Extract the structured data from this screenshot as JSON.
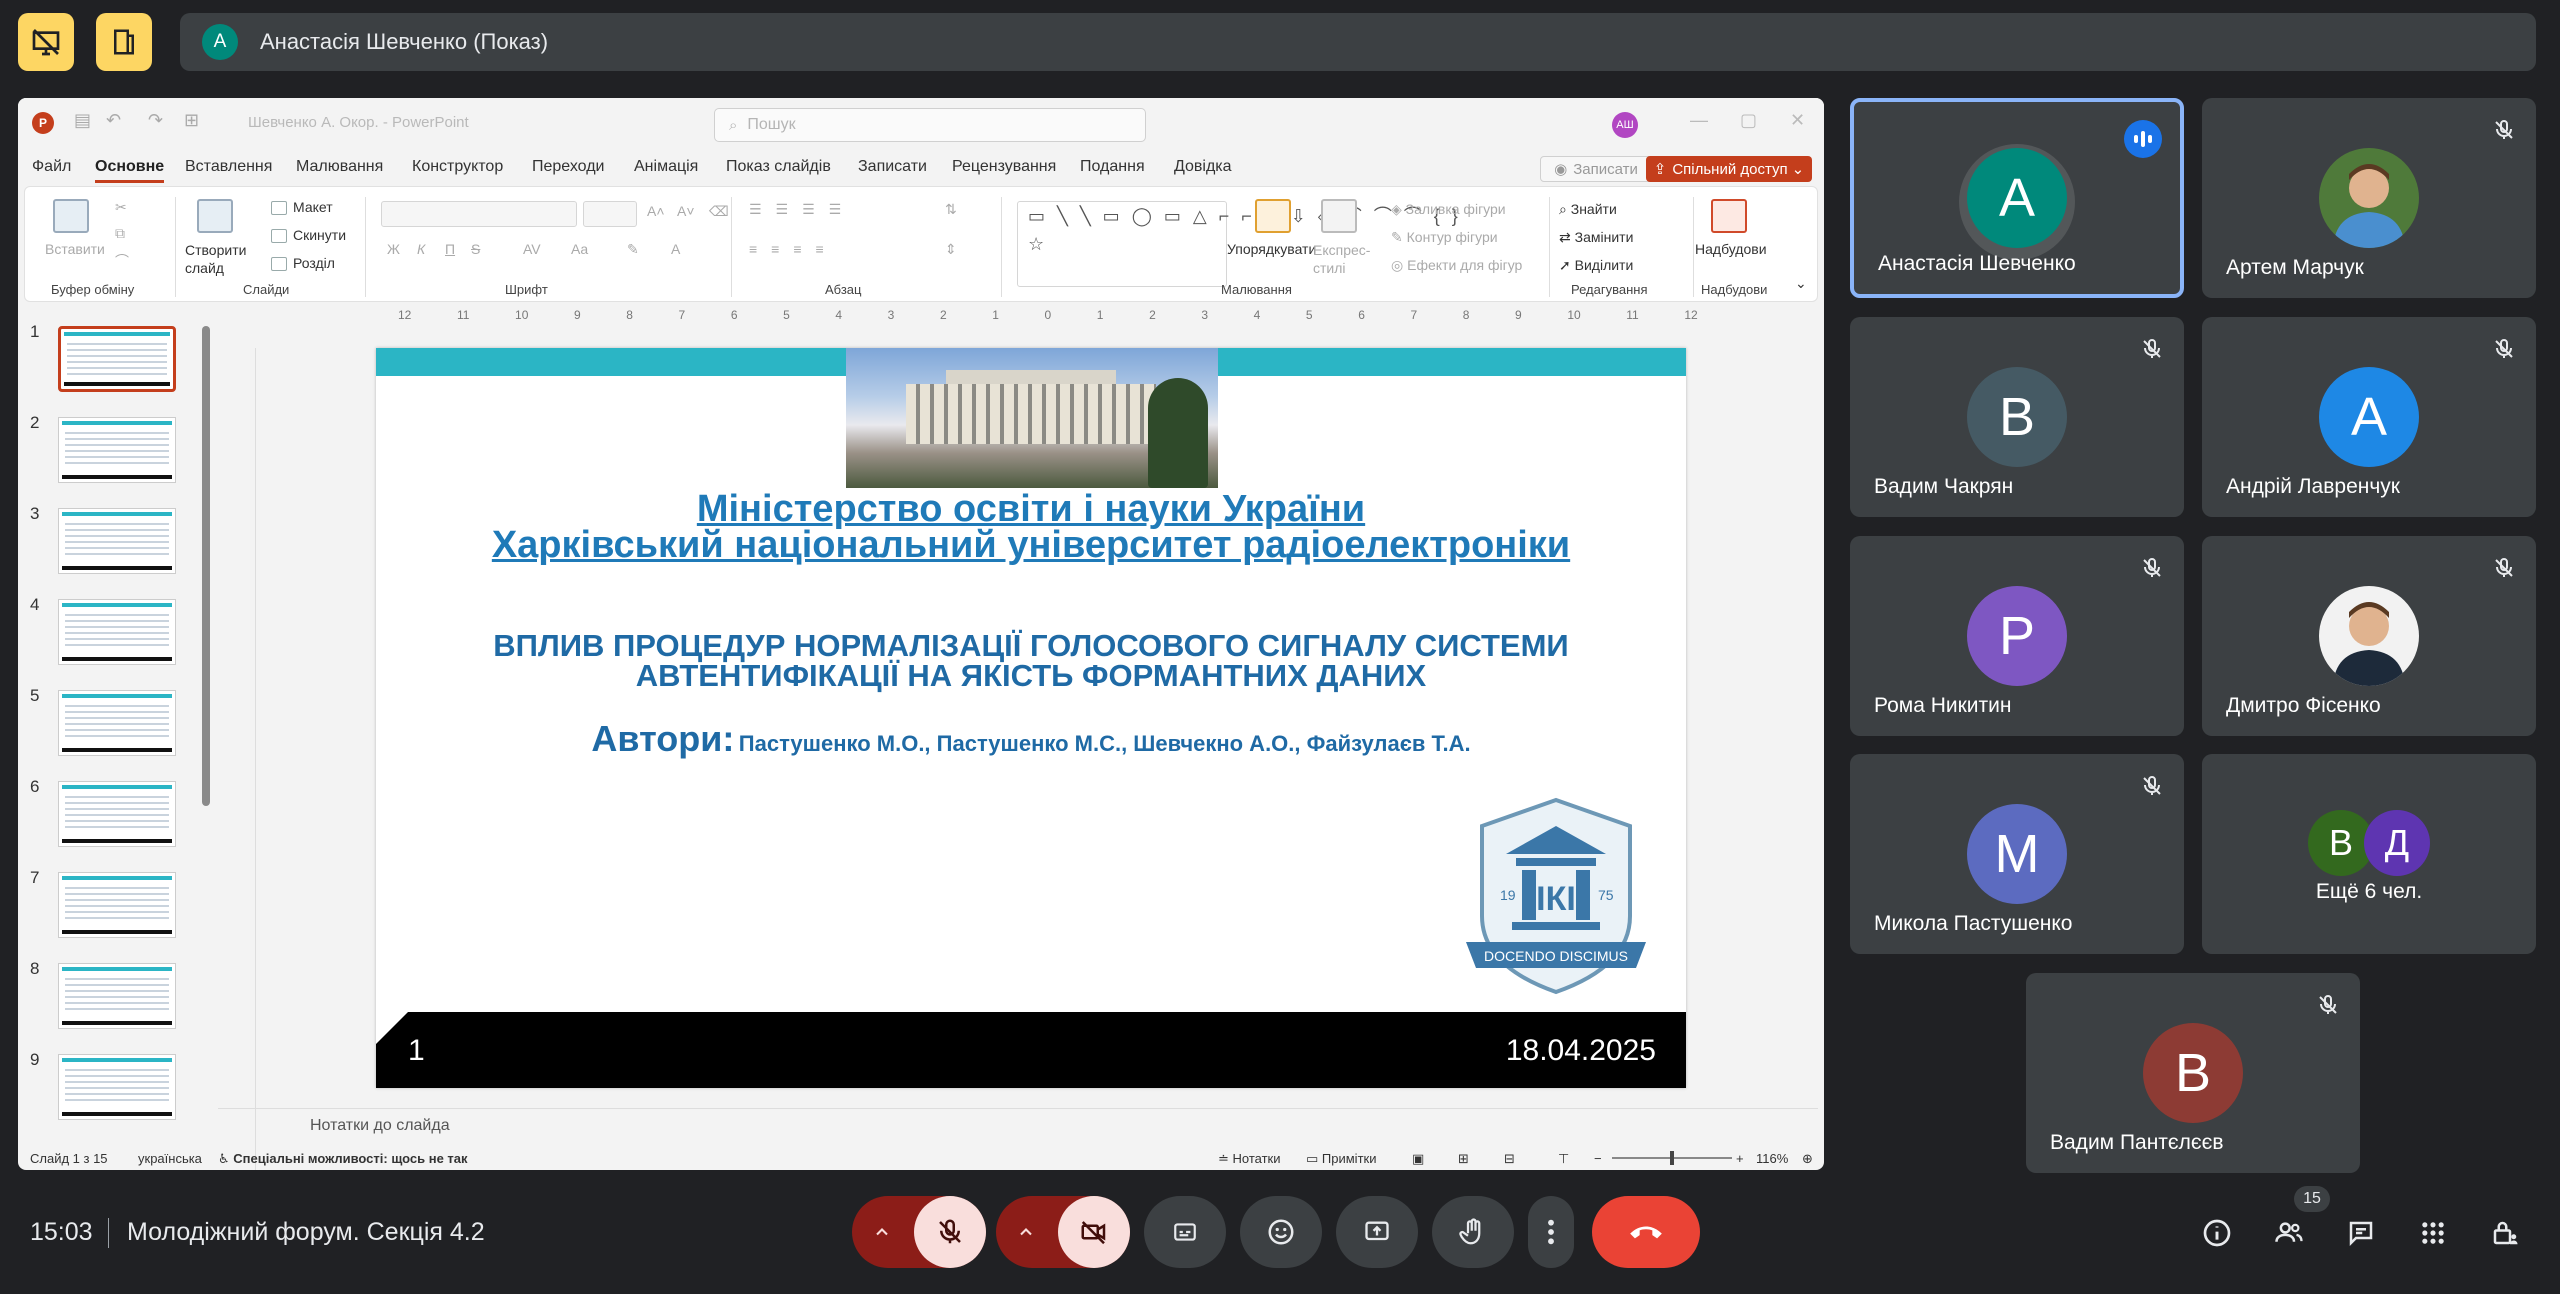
{
  "presenter": {
    "initial": "А",
    "label": "Анастасія Шевченко (Показ)"
  },
  "ppt": {
    "doc_title": "Шевченко А. Окор. - PowerPoint",
    "search_placeholder": "Пошук",
    "user_initials": "АШ",
    "menu": [
      "Файл",
      "Основне",
      "Вставлення",
      "Малювання",
      "Конструктор",
      "Переходи",
      "Анімація",
      "Показ слайдів",
      "Записати",
      "Рецензування",
      "Подання",
      "Довідка"
    ],
    "record_label": "Записати",
    "share_label": "Спільний доступ",
    "ribbon": {
      "paste": "Вставити",
      "new_slide": "Створити слайд",
      "layout": "Макет",
      "reset": "Скинути",
      "section": "Розділ",
      "arrange": "Упорядкувати",
      "quick_styles": "Експрес-стилі",
      "fill": "Заливка фігури",
      "outline": "Контур фігури",
      "effects": "Ефекти для фігур",
      "find": "Знайти",
      "replace": "Замінити",
      "select": "Виділити",
      "addins": "Надбудови",
      "groups": [
        "Буфер обміну",
        "Слайди",
        "Шрифт",
        "Абзац",
        "Малювання",
        "Редагування",
        "Надбудови"
      ],
      "font_btns": [
        "Ж",
        "К",
        "П",
        "S",
        "AV",
        "Aa"
      ]
    },
    "ruler": [
      "12",
      "11",
      "10",
      "9",
      "8",
      "7",
      "6",
      "5",
      "4",
      "3",
      "2",
      "1",
      "0",
      "1",
      "2",
      "3",
      "4",
      "5",
      "6",
      "7",
      "8",
      "9",
      "10",
      "11",
      "12"
    ],
    "thumb_numbers": [
      "1",
      "2",
      "3",
      "4",
      "5",
      "6",
      "7",
      "8",
      "9"
    ],
    "slide": {
      "title1": "Міністерство освіти і науки України",
      "title2": "Харківський національний університет радіоелектроніки",
      "heading1": "ВПЛИВ ПРОЦЕДУР НОРМАЛІЗАЦІЇ ГОЛОСОВОГО СИГНАЛУ СИСТЕМИ",
      "heading2": "АВТЕНТИФІКАЦІЇ НА ЯКІСТЬ ФОРМАНТНИХ ДАНИХ",
      "authors_label": "Автори:",
      "authors": "Пастушенко М.О., Пастушенко М.С., Шевчекно А.О., Файзулаєв Т.А.",
      "seal_left": "19",
      "seal_right": "75",
      "seal_center": "ІКІ",
      "seal_motto": "DOCENDO DISCIMUS",
      "number": "1",
      "date": "18.04.2025"
    },
    "notes_label": "Нотатки до слайда",
    "status": {
      "slide_info": "Слайд 1 з 15",
      "language": "українська",
      "accessibility": "Спеціальні можливості: щось не так",
      "notes": "Нотатки",
      "comments": "Примітки",
      "zoom": "116%"
    }
  },
  "participants": [
    {
      "name": "Анастасія Шевченко",
      "initial": "А",
      "color": "#00897b",
      "active": true,
      "speaking": true
    },
    {
      "name": "Артем Марчук",
      "photo": true,
      "muted": true
    },
    {
      "name": "Вадим Чакрян",
      "initial": "В",
      "color": "#455a64",
      "muted": true
    },
    {
      "name": "Андрій Лавренчук",
      "initial": "А",
      "color": "#1e88e5",
      "muted": true
    },
    {
      "name": "Рома Никитин",
      "initial": "Р",
      "color": "#7e57c2",
      "muted": true
    },
    {
      "name": "Дмитро Фісенко",
      "photo": true,
      "muted": true
    },
    {
      "name": "Микола Пастушенко",
      "initial": "М",
      "color": "#5c6bc0",
      "muted": true
    },
    {
      "name": "Вадим Пантєлєєв",
      "initial": "В",
      "color": "#8d3b34",
      "muted": true
    }
  ],
  "more": {
    "initial1": "В",
    "color1": "#33691e",
    "initial2": "Д",
    "color2": "#5e35b1",
    "label": "Ещё 6 чел."
  },
  "bottom": {
    "time": "15:03",
    "meeting": "Молодіжний форум. Секція 4.2",
    "participants_count": "15"
  }
}
